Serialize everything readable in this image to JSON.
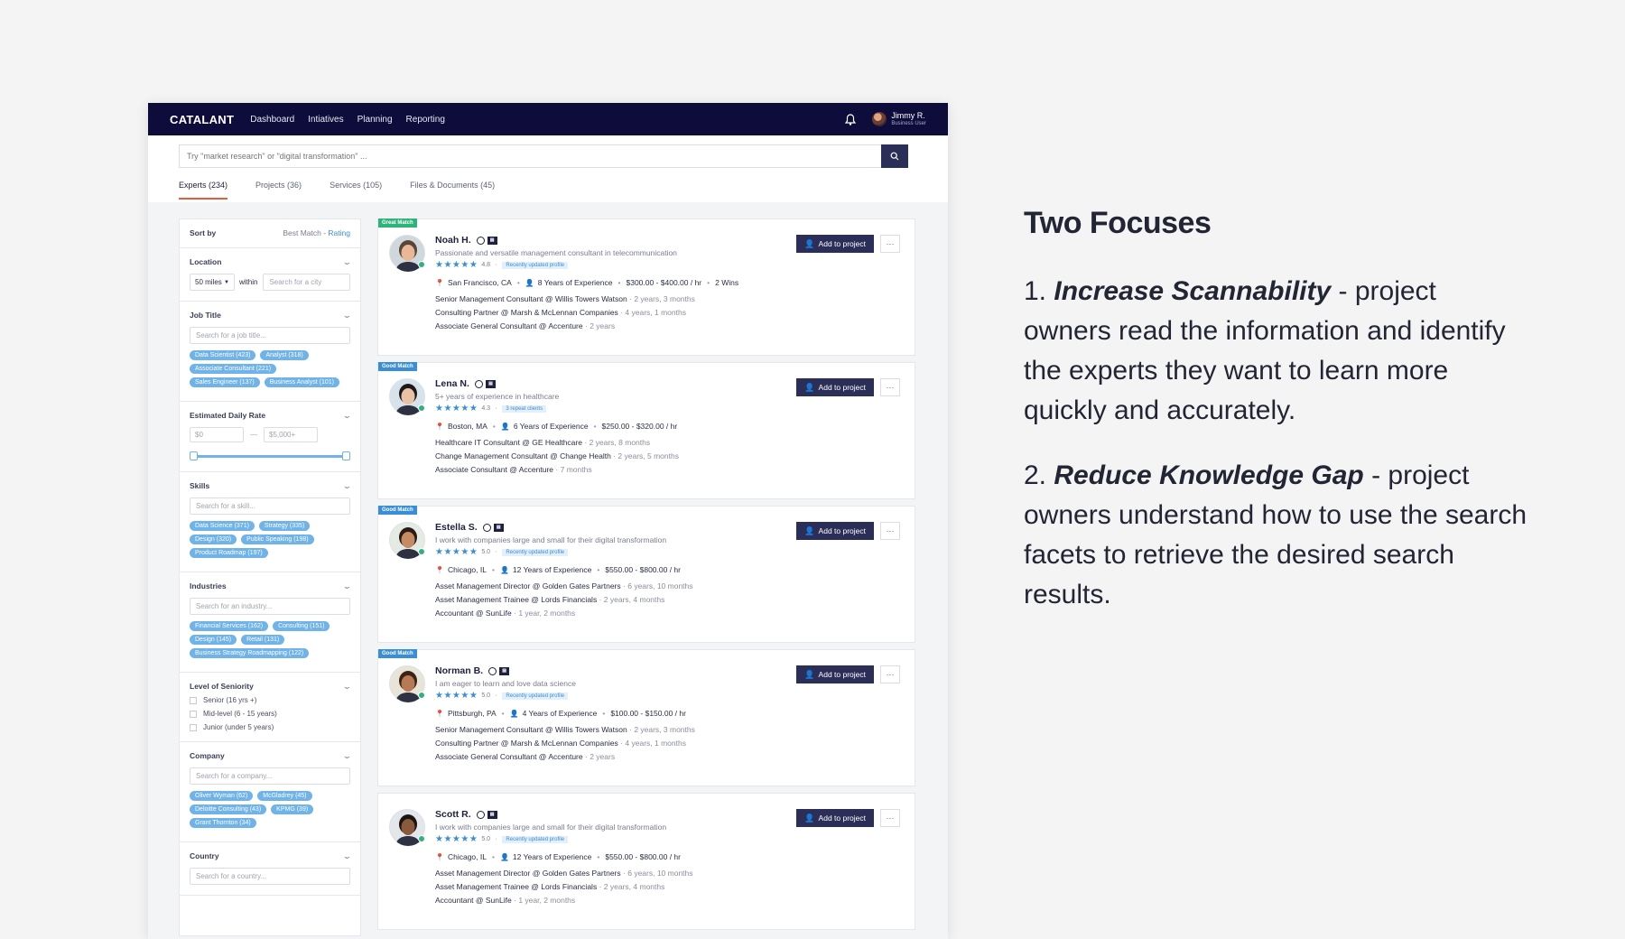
{
  "nav": {
    "logo": "CATALANT",
    "links": [
      "Dashboard",
      "Intiatives",
      "Planning",
      "Reporting"
    ],
    "user_name": "Jimmy R.",
    "user_role": "Business User"
  },
  "search": {
    "placeholder": "Try \"market research\" or \"digital transformation\" ..."
  },
  "tabs": [
    "Experts (234)",
    "Projects (36)",
    "Services (105)",
    "Files & Documents (45)"
  ],
  "filters": {
    "sort_label": "Sort by",
    "sort_current": "Best Match - ",
    "sort_alt": "Rating",
    "location": {
      "title": "Location",
      "radius": "50 miles",
      "within": "within",
      "city_placeholder": "Search for a city"
    },
    "job_title": {
      "title": "Job Title",
      "placeholder": "Search for a job title...",
      "chips": [
        "Data Scientist (423)",
        "Analyst (318)",
        "Associate Consultant (221)",
        "Sales Engineer (137)",
        "Business Analyst (101)"
      ]
    },
    "rate": {
      "title": "Estimated Daily Rate",
      "min": "$0",
      "max": "$5,000+",
      "dash": "—"
    },
    "skills": {
      "title": "Skills",
      "placeholder": "Search for a skill...",
      "chips": [
        "Data Science (371)",
        "Strategy (335)",
        "Design (320)",
        "Public Speaking (198)",
        "Product Roadmap (197)"
      ]
    },
    "industries": {
      "title": "Industries",
      "placeholder": "Search for an industry...",
      "chips": [
        "Financial Services (162)",
        "Consulting (151)",
        "Design (145)",
        "Retail (131)",
        "Business Strategy Roadmapping (122)"
      ]
    },
    "seniority": {
      "title": "Level of Seniority",
      "options": [
        "Senior (16 yrs +)",
        "Mid-level (6 - 15 years)",
        "Junior (under 5 years)"
      ]
    },
    "company": {
      "title": "Company",
      "placeholder": "Search for a company...",
      "chips": [
        "Oliver Wyman (62)",
        "McGladrey (45)",
        "Deloitte Consulting (43)",
        "KPMG (39)",
        "Grant Thornton (34)"
      ]
    },
    "country": {
      "title": "Country",
      "placeholder": "Search for a country..."
    }
  },
  "experts": [
    {
      "badge": "Great Match",
      "badge_type": "great",
      "name": "Noah H.",
      "headline": "Passionate and versatile management consultant in telecommunication",
      "rating": "4.8",
      "tag": "Recently updated profile",
      "location": "San Francisco, CA",
      "experience": "8 Years of Experience",
      "rate": "$300.00 - $400.00 / hr",
      "wins": "2 Wins",
      "jobs": [
        {
          "title": "Senior Management Consultant @ Willis Towers Watson",
          "dur": "2 years, 3 months"
        },
        {
          "title": "Consulting Partner @ Marsh & McLennan Companies",
          "dur": "4 years, 1 months"
        },
        {
          "title": "Associate General Consultant @ Accenture",
          "dur": "2 years"
        }
      ]
    },
    {
      "badge": "Good Match",
      "badge_type": "good",
      "name": "Lena N.",
      "headline": "5+ years of experience in healthcare",
      "rating": "4.3",
      "tag": "3 repeat clients",
      "location": "Boston, MA",
      "experience": "6 Years of Experience",
      "rate": "$250.00 - $320.00 / hr",
      "wins": "",
      "jobs": [
        {
          "title": "Healthcare IT Consultant @ GE Healthcare",
          "dur": "2 years, 8 months"
        },
        {
          "title": "Change Management Consultant @ Change Health",
          "dur": "2 years, 5 months"
        },
        {
          "title": "Associate Consultant @ Accenture",
          "dur": "7 months"
        }
      ]
    },
    {
      "badge": "Good Match",
      "badge_type": "good",
      "name": "Estella S.",
      "headline": "I work with companies large and small for their digital transformation",
      "rating": "5.0",
      "tag": "Recently updated profile",
      "location": "Chicago, IL",
      "experience": "12 Years of Experience",
      "rate": "$550.00 - $800.00 / hr",
      "wins": "",
      "jobs": [
        {
          "title": "Asset Management Director @ Golden Gates Partners",
          "dur": "6 years, 10 months"
        },
        {
          "title": "Asset Management Trainee @ Lords Financials",
          "dur": "2 years, 4 months"
        },
        {
          "title": "Accountant @ SunLife",
          "dur": "1 year, 2 months"
        }
      ]
    },
    {
      "badge": "Good Match",
      "badge_type": "good",
      "name": "Norman B.",
      "headline": "I am eager to learn and love data science",
      "rating": "5.0",
      "tag": "Recently updated profile",
      "location": "Pittsburgh, PA",
      "experience": "4 Years of Experience",
      "rate": "$100.00 - $150.00 / hr",
      "wins": "",
      "jobs": [
        {
          "title": "Senior Management Consultant @ Willis Towers Watson",
          "dur": "2 years, 3 months"
        },
        {
          "title": "Consulting Partner @ Marsh & McLennan Companies",
          "dur": "4 years, 1 months"
        },
        {
          "title": "Associate General Consultant @ Accenture",
          "dur": "2 years"
        }
      ]
    },
    {
      "badge": "",
      "badge_type": "",
      "name": "Scott R.",
      "headline": "I work with companies large and small for their digital transformation",
      "rating": "5.0",
      "tag": "Recently updated profile",
      "location": "Chicago, IL",
      "experience": "12 Years of Experience",
      "rate": "$550.00 - $800.00 / hr",
      "wins": "",
      "jobs": [
        {
          "title": "Asset Management Director @ Golden Gates Partners",
          "dur": "6 years, 10 months"
        },
        {
          "title": "Asset Management Trainee @ Lords Financials",
          "dur": "2 years, 4 months"
        },
        {
          "title": "Accountant @ SunLife",
          "dur": "1 year, 2 months"
        }
      ]
    }
  ],
  "card_actions": {
    "add": "Add to project",
    "more": "···"
  },
  "aside": {
    "title": "Two Focuses",
    "points": [
      {
        "num": "1. ",
        "bold": "Increase Scannability",
        "text": " - project owners read the information and identify the experts they want to learn more quickly and accurately."
      },
      {
        "num": "2. ",
        "bold": "Reduce Knowledge Gap",
        "text": " - project owners understand how to use the search facets to retrieve the desired search results."
      }
    ]
  },
  "colors": {
    "nav_bg": "#0d0c3a",
    "accent": "#e55d3f",
    "chip": "#6fb3e8",
    "great": "#2eb47a",
    "good": "#3a8ed6",
    "button": "#2b2e57"
  }
}
